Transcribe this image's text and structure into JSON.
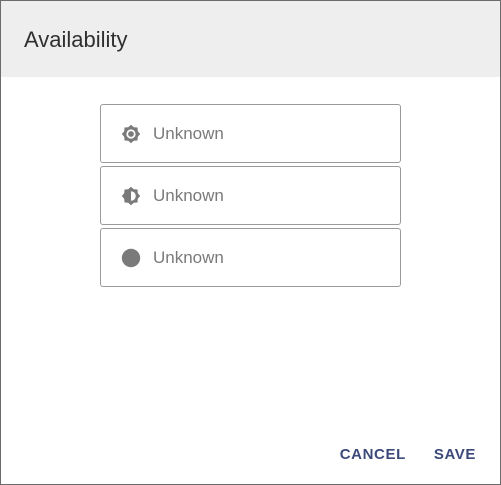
{
  "dialog": {
    "title": "Availability"
  },
  "options": [
    {
      "icon": "brightness-gear-icon",
      "label": "Unknown"
    },
    {
      "icon": "brightness-half-icon",
      "label": "Unknown"
    },
    {
      "icon": "filled-circle-icon",
      "label": "Unknown"
    }
  ],
  "actions": {
    "cancel_label": "CANCEL",
    "save_label": "SAVE"
  },
  "colors": {
    "header_background": "#eeeeee",
    "icon": "#7a7a7a",
    "accent": "#3b4a7a",
    "border": "#9a9a9a"
  }
}
